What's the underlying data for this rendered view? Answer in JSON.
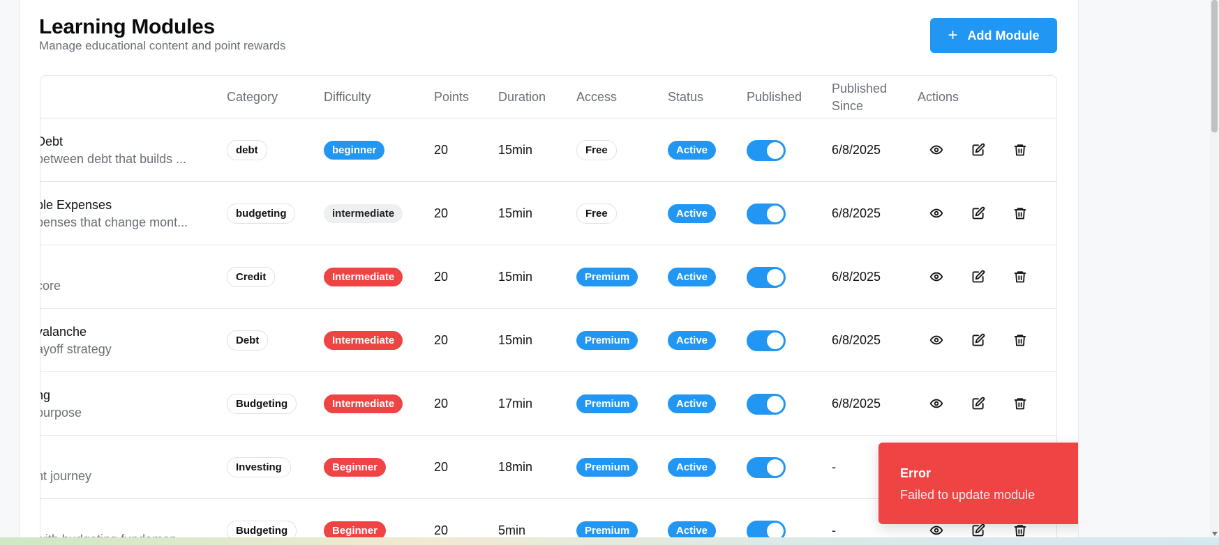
{
  "header": {
    "title": "Learning Modules",
    "subtitle": "Manage educational content and point rewards",
    "add_button_label": "Add Module",
    "add_button_icon": "plus-icon"
  },
  "table": {
    "columns": [
      "Category",
      "Difficulty",
      "Points",
      "Duration",
      "Access",
      "Status",
      "Published",
      "Published Since",
      "Actions"
    ],
    "column_published_since_line1": "Published",
    "column_published_since_line2": "Since",
    "rows": [
      {
        "title": "Debt",
        "description": "between debt that builds ...",
        "category": "debt",
        "difficulty": "beginner",
        "difficulty_style": "blue",
        "points": "20",
        "duration": "15min",
        "access": "Free",
        "access_style": "outline",
        "status": "Active",
        "published": true,
        "published_since": "6/8/2025"
      },
      {
        "title": "ble Expenses",
        "description": "penses that change mont...",
        "category": "budgeting",
        "difficulty": "intermediate",
        "difficulty_style": "gray",
        "points": "20",
        "duration": "15min",
        "access": "Free",
        "access_style": "outline",
        "status": "Active",
        "published": true,
        "published_since": "6/8/2025"
      },
      {
        "title": "",
        "description": "core",
        "category": "Credit",
        "difficulty": "Intermediate",
        "difficulty_style": "red",
        "points": "20",
        "duration": "15min",
        "access": "Premium",
        "access_style": "blue",
        "status": "Active",
        "published": true,
        "published_since": "6/8/2025"
      },
      {
        "title": "valanche",
        "description": "ayoff strategy",
        "category": "Debt",
        "difficulty": "Intermediate",
        "difficulty_style": "red",
        "points": "20",
        "duration": "15min",
        "access": "Premium",
        "access_style": "blue",
        "status": "Active",
        "published": true,
        "published_since": "6/8/2025"
      },
      {
        "title": "ng",
        "description": "purpose",
        "category": "Budgeting",
        "difficulty": "Intermediate",
        "difficulty_style": "red",
        "points": "20",
        "duration": "17min",
        "access": "Premium",
        "access_style": "blue",
        "status": "Active",
        "published": true,
        "published_since": "6/8/2025"
      },
      {
        "title": "",
        "description": "nt journey",
        "category": "Investing",
        "difficulty": "Beginner",
        "difficulty_style": "red",
        "points": "20",
        "duration": "18min",
        "access": "Premium",
        "access_style": "blue",
        "status": "Active",
        "published": true,
        "published_since": "-"
      },
      {
        "title": "",
        "description": "with budgeting fundamen...",
        "category": "Budgeting",
        "difficulty": "Beginner",
        "difficulty_style": "red",
        "points": "20",
        "duration": "5min",
        "access": "Premium",
        "access_style": "blue",
        "status": "Active",
        "published": true,
        "published_since": "-"
      }
    ],
    "action_icons": [
      "eye-icon",
      "edit-icon",
      "trash-icon"
    ]
  },
  "toast": {
    "title": "Error",
    "message": "Failed to update module",
    "close_icon": "close-icon"
  },
  "colors": {
    "accent": "#2196f3",
    "danger": "#ef4444",
    "muted_text": "#6b6f76"
  }
}
